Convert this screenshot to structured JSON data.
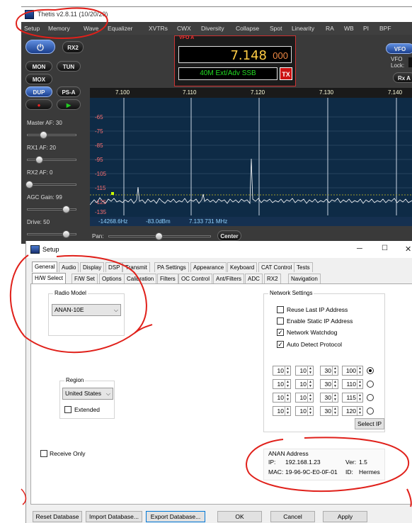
{
  "thetis": {
    "title": "Thetis v2.8.11 (10/20/20)",
    "menu": [
      "Setup",
      "Memory",
      "Wave",
      "Equalizer",
      "XVTRs",
      "CWX",
      "Diversity",
      "Collapse",
      "Spot",
      "Linearity",
      "RA",
      "WB",
      "PI",
      "BPF"
    ],
    "buttons": {
      "rx2": "RX2",
      "mon": "MON",
      "tun": "TUN",
      "mox": "MOX",
      "dup": "DUP",
      "psa": "PS-A"
    },
    "master_af": "Master AF:  30",
    "rx1_af": "RX1 AF:  20",
    "rx2_af": "RX2 AF:  0",
    "agc_gain": "AGC Gain:  99",
    "drive": "Drive:  50",
    "vfo": {
      "label": "VFO A",
      "freq_main": "7.148",
      "freq_sub": "000",
      "band_mode": "40M Ext/Adv SSB",
      "tx": "TX"
    },
    "right": {
      "vfo_btn": "VFO",
      "vfo_lock": "VFO\nLock:",
      "rx_btn": "Rx A"
    },
    "freq_scale": [
      "7.100",
      "7.110",
      "7.120",
      "7.130",
      "7.140"
    ],
    "db_scale": [
      "-65",
      "-75",
      "-85",
      "-95",
      "-105",
      "-115",
      "-125",
      "-135"
    ],
    "status": {
      "offset": "-14268.6Hz",
      "level": "-83.0dBm",
      "cursor": "7.133 731 MHz"
    },
    "pan_label": "Pan:",
    "center_btn": "Center",
    "agc_partial": "AGC"
  },
  "setup": {
    "title": "Setup",
    "tabs_row1": [
      "General",
      "Audio",
      "Display",
      "DSP",
      "Transmit",
      "PA Settings",
      "Appearance",
      "Keyboard",
      "CAT Control",
      "Tests"
    ],
    "tabs_row2": [
      "H/W Select",
      "F/W Set",
      "Options",
      "Calibration",
      "Filters",
      "OC Control",
      "Ant/Filters",
      "ADC",
      "RX2",
      "Navigation"
    ],
    "radio_model": {
      "title": "Radio Model",
      "value": "ANAN-10E"
    },
    "network": {
      "title": "Network Settings",
      "reuse_ip": "Reuse Last IP Address",
      "static_ip": "Enable Static IP Address",
      "watchdog": "Network Watchdog",
      "auto_detect": "Auto Detect Protocol",
      "ip_rows": [
        [
          "10",
          "10",
          "30",
          "100"
        ],
        [
          "10",
          "10",
          "30",
          "110"
        ],
        [
          "10",
          "10",
          "30",
          "115"
        ],
        [
          "10",
          "10",
          "30",
          "120"
        ]
      ],
      "select_ip": "Select IP"
    },
    "region": {
      "title": "Region",
      "value": "United States",
      "extended": "Extended"
    },
    "receive_only": "Receive Only",
    "anan_address": {
      "title": "ANAN Address",
      "ip_label": "IP:",
      "ip": "192.168.1.23",
      "ver_label": "Ver:",
      "ver": "1.5",
      "mac_label": "MAC:",
      "mac": "19-96-9C-E0-0F-01",
      "id_label": "ID:",
      "id": "Hermes"
    },
    "bottom_buttons": {
      "reset_db": "Reset Database",
      "import_db": "Import Database...",
      "export_db": "Export Database...",
      "ok": "OK",
      "cancel": "Cancel",
      "apply": "Apply"
    }
  },
  "colors": {
    "annotation": "#e0201a",
    "vfo_freq": "#ffcc44",
    "mode_green": "#22dd22"
  }
}
